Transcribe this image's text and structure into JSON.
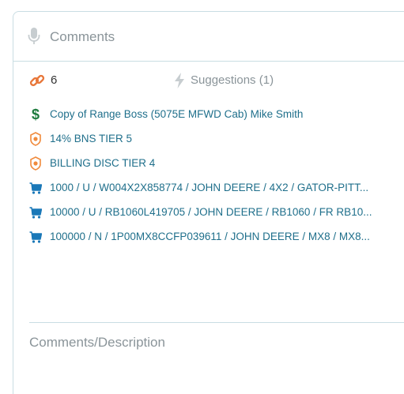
{
  "panel": {
    "title": "Comments",
    "links_count": "6",
    "suggestions_label": "Suggestions (1)",
    "description_label": "Comments/Description",
    "colors": {
      "accent": "#1f6f8b",
      "muted": "#8a9499",
      "link_icon": "#e8773a",
      "dollar_icon": "#1b7a3c",
      "badge_icon": "#f08a3c",
      "cart_icon": "#1a78b8",
      "border": "#c9dde3"
    },
    "items": [
      {
        "icon": "dollar-icon",
        "text": "Copy of Range Boss (5075E MFWD Cab) Mike Smith"
      },
      {
        "icon": "badge-icon",
        "text": "14% BNS TIER 5"
      },
      {
        "icon": "badge-icon",
        "text": "BILLING DISC TIER 4"
      },
      {
        "icon": "cart-icon",
        "text": "1000 / U / W004X2X858774 / JOHN DEERE / 4X2 / GATOR-PITT..."
      },
      {
        "icon": "cart-icon",
        "text": "10000 / U / RB1060L419705 / JOHN DEERE / RB1060 / FR RB10..."
      },
      {
        "icon": "cart-icon",
        "text": "100000 / N / 1P00MX8CCFP039611 / JOHN DEERE / MX8 / MX8..."
      }
    ]
  }
}
